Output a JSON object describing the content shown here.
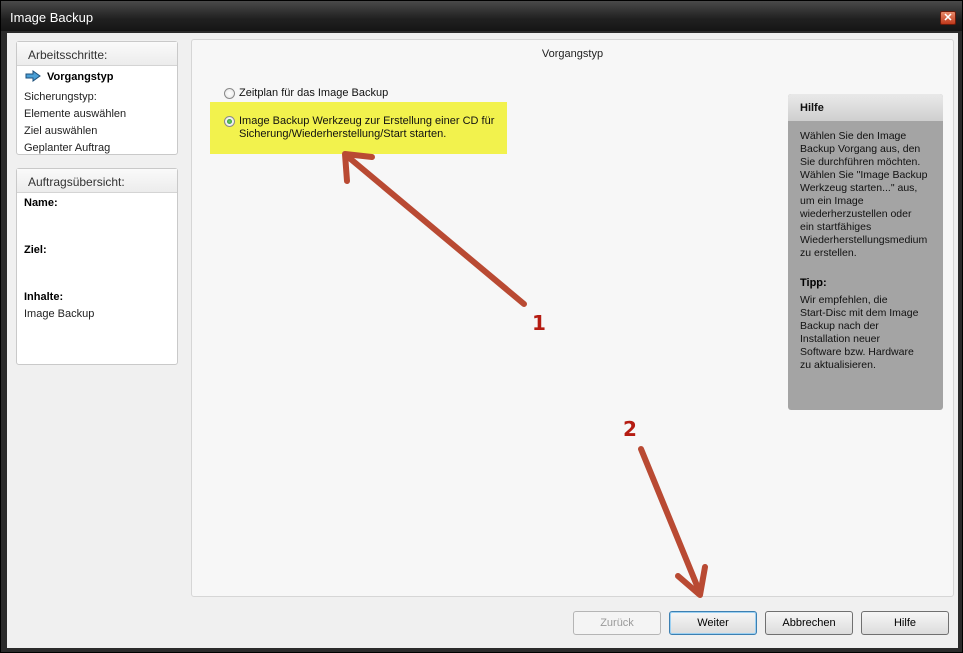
{
  "window": {
    "title": "Image Backup"
  },
  "steps": {
    "header": "Arbeitsschritte:",
    "items": [
      "Vorgangstyp",
      "Sicherungstyp:",
      "Elemente auswählen",
      "Ziel auswählen",
      "Geplanter Auftrag"
    ]
  },
  "summary": {
    "header": "Auftragsübersicht:",
    "name_label": "Name:",
    "target_label": "Ziel:",
    "contents_label": "Inhalte:",
    "contents_value": "Image Backup"
  },
  "main": {
    "title": "Vorgangstyp",
    "option1": "Zeitplan für das Image Backup",
    "option2_line1": "Image Backup Werkzeug zur Erstellung einer CD für",
    "option2_line2": "Sicherung/Wiederherstellung/Start starten.",
    "selected_option": 2
  },
  "help": {
    "title": "Hilfe",
    "lines": [
      "Wählen Sie den Image",
      "Backup Vorgang aus, den",
      "Sie durchführen möchten.",
      "Wählen Sie \"Image Backup",
      "Werkzeug starten...\" aus,",
      "um ein Image",
      "wiederherzustellen oder",
      "ein startfähiges",
      "Wiederherstellungsmedium",
      "zu erstellen."
    ],
    "tip_title": "Tipp:",
    "tip_lines": [
      "Wir empfehlen, die",
      "Start-Disc mit dem Image",
      "Backup nach der",
      "Installation neuer",
      "Software bzw. Hardware",
      "zu aktualisieren."
    ]
  },
  "buttons": {
    "back": "Zurück",
    "next": "Weiter",
    "cancel": "Abbrechen",
    "help": "Hilfe"
  },
  "annotations": {
    "label1": "1",
    "label2": "2",
    "color": "#b51c12"
  },
  "colors": {
    "highlight": "#f2f24d",
    "help_box": "#a4a4a4",
    "radio_selected": "#1f8a1f"
  }
}
